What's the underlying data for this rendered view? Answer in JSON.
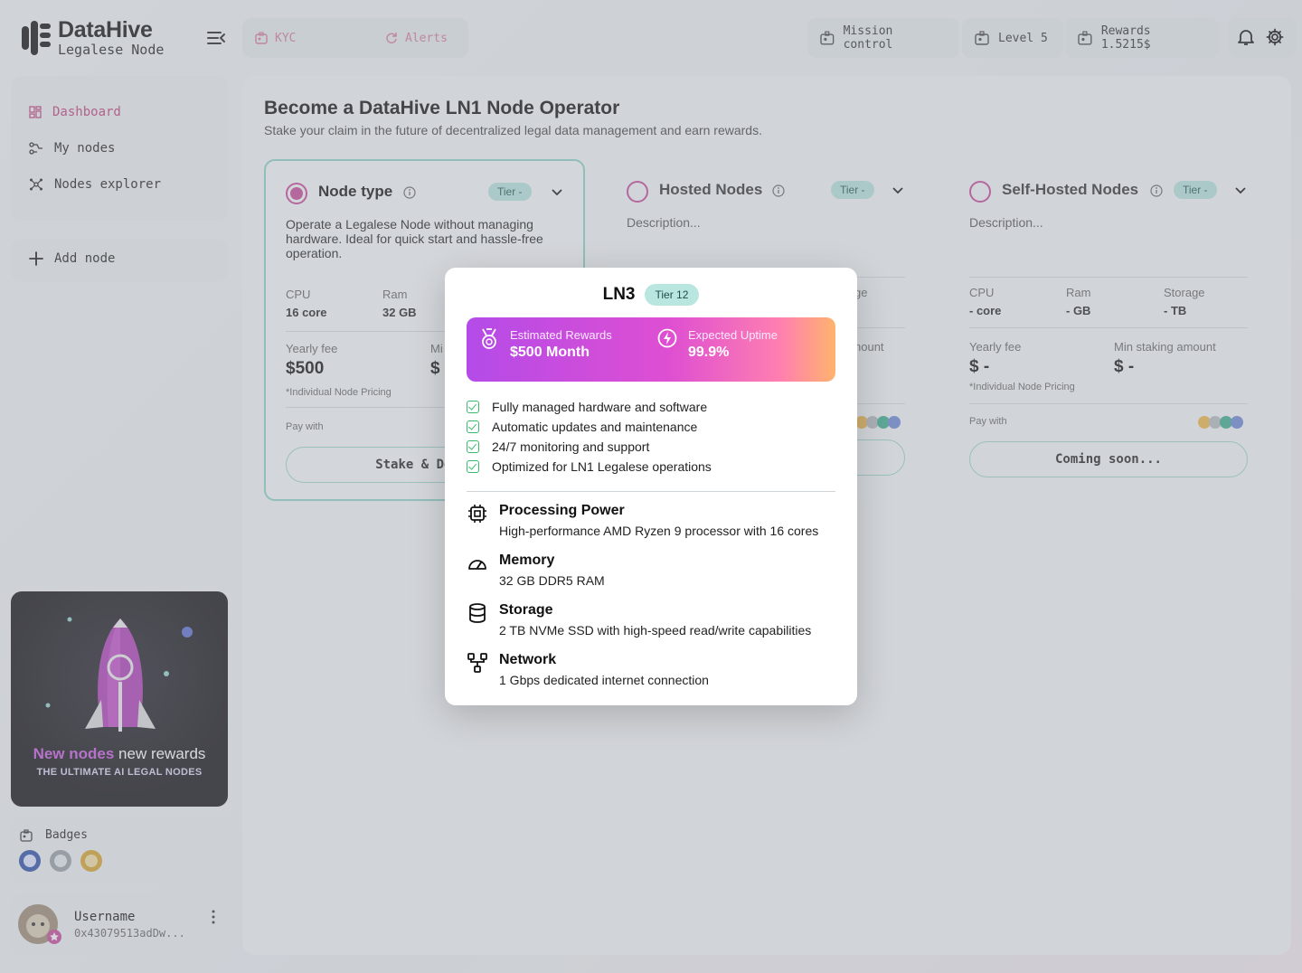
{
  "app": {
    "brand_name": "DataHive",
    "brand_sub": "Legalese Node"
  },
  "topbar": {
    "kyc_label": "KYC",
    "alerts_label": "Alerts",
    "mission_label": "Mission control",
    "level_label": "Level 5",
    "rewards_label": "Rewards 1.5215$"
  },
  "sidebar": {
    "items": [
      {
        "label": "Dashboard",
        "icon": "dashboard-icon",
        "active": true
      },
      {
        "label": "My nodes",
        "icon": "nodes-icon",
        "active": false
      },
      {
        "label": "Nodes explorer",
        "icon": "explorer-icon",
        "active": false
      }
    ],
    "add_node_label": "Add node",
    "promo": {
      "headline_accent": "New nodes",
      "headline_rest": " new rewards",
      "subline": "THE ULTIMATE AI LEGAL NODES"
    },
    "badges_label": "Badges",
    "user": {
      "name": "Username",
      "address": "0x43079513adDw..."
    }
  },
  "main": {
    "title": "Become a DataHive LN1 Node Operator",
    "subtitle": "Stake your claim in the future of decentralized legal data management and earn rewards.",
    "cards": [
      {
        "title": "Node type",
        "tier": "Tier -",
        "description": "Operate a Legalese Node without managing hardware. Ideal for quick start and hassle-free operation.",
        "cpu_label": "CPU",
        "cpu_value": "16 core",
        "ram_label": "Ram",
        "ram_value": "32 GB",
        "fee_label": "Yearly fee",
        "fee_value": "$500",
        "min_label": "Mi",
        "min_value": "$",
        "pricing_note": "*Individual Node Pricing",
        "pay_label": "Pay with",
        "cta": "Stake & Deplo"
      },
      {
        "title": "Hosted Nodes",
        "tier": "Tier -",
        "description": "Description...",
        "storage_partial": "ge",
        "min_partial": "nount"
      },
      {
        "title": "Self-Hosted Nodes",
        "tier": "Tier -",
        "description": "Description...",
        "cpu_label": "CPU",
        "cpu_value": "- core",
        "ram_label": "Ram",
        "ram_value": "- GB",
        "storage_label": "Storage",
        "storage_value": "- TB",
        "fee_label": "Yearly fee",
        "fee_value": "$ -",
        "min_label": "Min staking amount",
        "min_value": "$ -",
        "pricing_note": "*Individual Node Pricing",
        "pay_label": "Pay with",
        "cta": "Coming soon..."
      }
    ]
  },
  "modal": {
    "name": "LN3",
    "tier": "Tier 12",
    "rewards_label": "Estimated Rewards",
    "rewards_value": "$500 Month",
    "uptime_label": "Expected Uptime",
    "uptime_value": "99.9%",
    "features": [
      "Fully managed hardware and software",
      "Automatic updates and maintenance",
      "24/7 monitoring and support",
      "Optimized for LN1 Legalese operations"
    ],
    "specs": [
      {
        "name": "Processing Power",
        "desc": "High-performance AMD Ryzen 9 processor with 16 cores",
        "icon": "cpu-icon"
      },
      {
        "name": "Memory",
        "desc": "32 GB DDR5 RAM",
        "icon": "gauge-icon"
      },
      {
        "name": "Storage",
        "desc": "2 TB NVMe SSD with high-speed read/write capabilities",
        "icon": "database-icon"
      },
      {
        "name": "Network",
        "desc": "1 Gbps dedicated internet connection",
        "icon": "network-icon"
      }
    ]
  },
  "colors": {
    "accent_pink": "#c9499a",
    "teal_badge": "#b9e6df",
    "check_green": "#3cb96d"
  }
}
